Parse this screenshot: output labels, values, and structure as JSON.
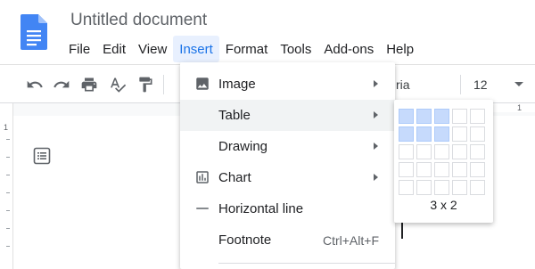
{
  "document": {
    "title": "Untitled document"
  },
  "menubar": [
    {
      "label": "File"
    },
    {
      "label": "Edit"
    },
    {
      "label": "View"
    },
    {
      "label": "Insert",
      "active": true
    },
    {
      "label": "Format"
    },
    {
      "label": "Tools"
    },
    {
      "label": "Add-ons"
    },
    {
      "label": "Help"
    }
  ],
  "toolbar": {
    "buttons": [
      "undo-icon",
      "redo-icon",
      "print-icon",
      "spellcheck-icon",
      "paint-format-icon"
    ],
    "font_name": "ria",
    "font_size": "12"
  },
  "ruler": {
    "top_number": "1",
    "left_number": "1"
  },
  "insert_menu": {
    "items": [
      {
        "label": "Image",
        "icon": "image-icon",
        "submenu": true
      },
      {
        "label": "Table",
        "icon": "",
        "submenu": true,
        "hover": true
      },
      {
        "label": "Drawing",
        "icon": "",
        "submenu": true
      },
      {
        "label": "Chart",
        "icon": "chart-icon",
        "submenu": true
      },
      {
        "label": "Horizontal line",
        "icon": "horizontal-line-icon",
        "submenu": false
      },
      {
        "label": "Footnote",
        "icon": "",
        "shortcut": "Ctrl+Alt+F"
      }
    ]
  },
  "table_grid": {
    "columns": 5,
    "rows": 5,
    "selected_cols": 3,
    "selected_rows": 2,
    "label": "3 x 2"
  },
  "colors": {
    "accent": "#1a73e8",
    "doc_blue": "#4285f4",
    "grid_selected": "#c6dafc"
  }
}
